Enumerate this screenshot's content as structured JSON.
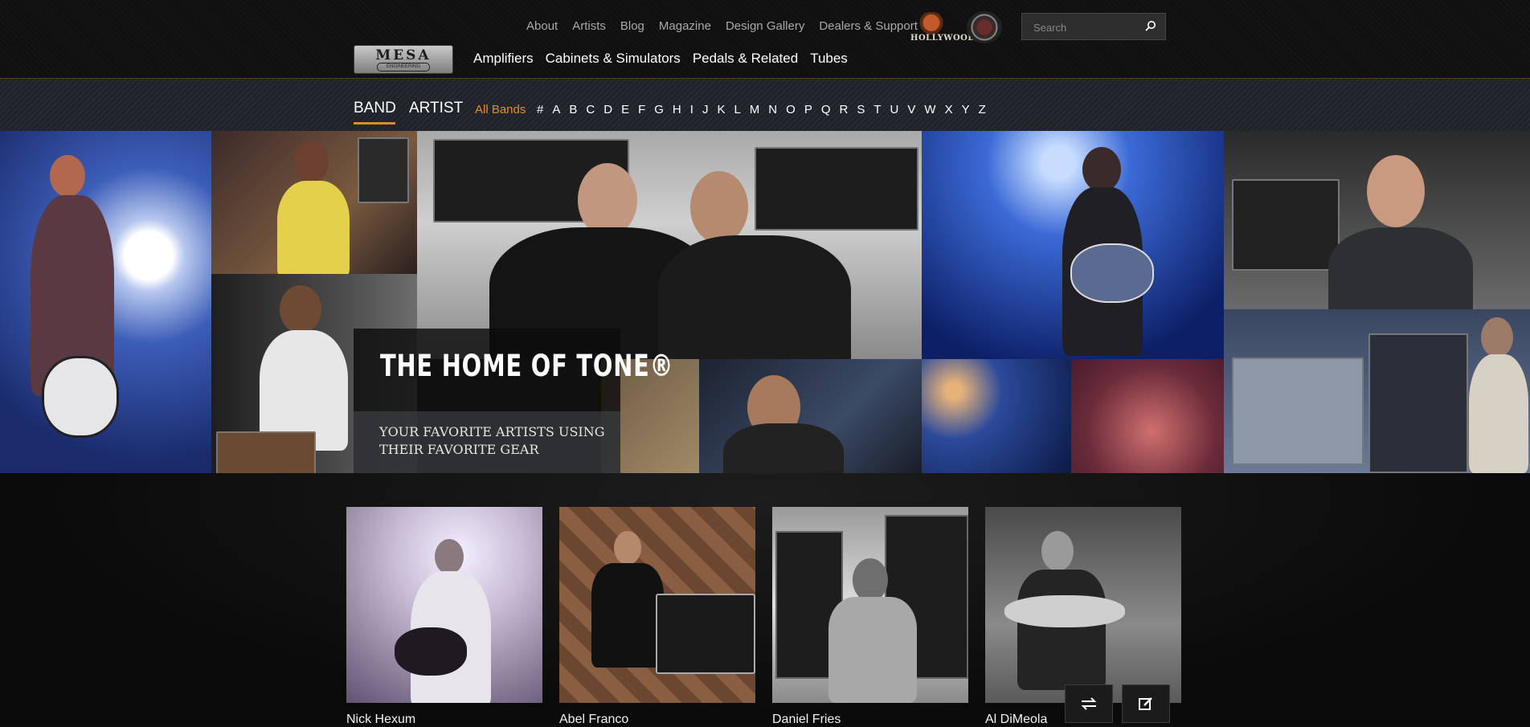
{
  "header": {
    "util_nav": [
      "About",
      "Artists",
      "Blog",
      "Magazine",
      "Design Gallery",
      "Dealers & Support"
    ],
    "hollywood_logo_text": "HOLLYWOOD",
    "search_placeholder": "Search",
    "logo_word": "MESA",
    "logo_sub": "ENGINEERING",
    "main_nav": [
      "Amplifiers",
      "Cabinets & Simulators",
      "Pedals & Related",
      "Tubes"
    ]
  },
  "filter": {
    "tabs": [
      "BAND",
      "ARTIST"
    ],
    "active_tab": "BAND",
    "all_label": "All Bands",
    "letters": [
      "#",
      "A",
      "B",
      "C",
      "D",
      "E",
      "F",
      "G",
      "H",
      "I",
      "J",
      "K",
      "L",
      "M",
      "N",
      "O",
      "P",
      "Q",
      "R",
      "S",
      "T",
      "U",
      "V",
      "W",
      "X",
      "Y",
      "Z"
    ]
  },
  "hero": {
    "title": "THE HOME OF TONE®",
    "subtitle": "YOUR FAVORITE ARTISTS USING THEIR FAVORITE GEAR"
  },
  "artists": [
    {
      "name": "Nick Hexum"
    },
    {
      "name": "Abel Franco"
    },
    {
      "name": "Daniel Fries"
    },
    {
      "name": "Al DiMeola"
    }
  ],
  "colors": {
    "accent": "#e08a2a",
    "header_bg": "#111111",
    "filter_bg": "#23272d"
  },
  "floating_buttons": [
    "swap-arrows-icon",
    "edit-icon"
  ]
}
